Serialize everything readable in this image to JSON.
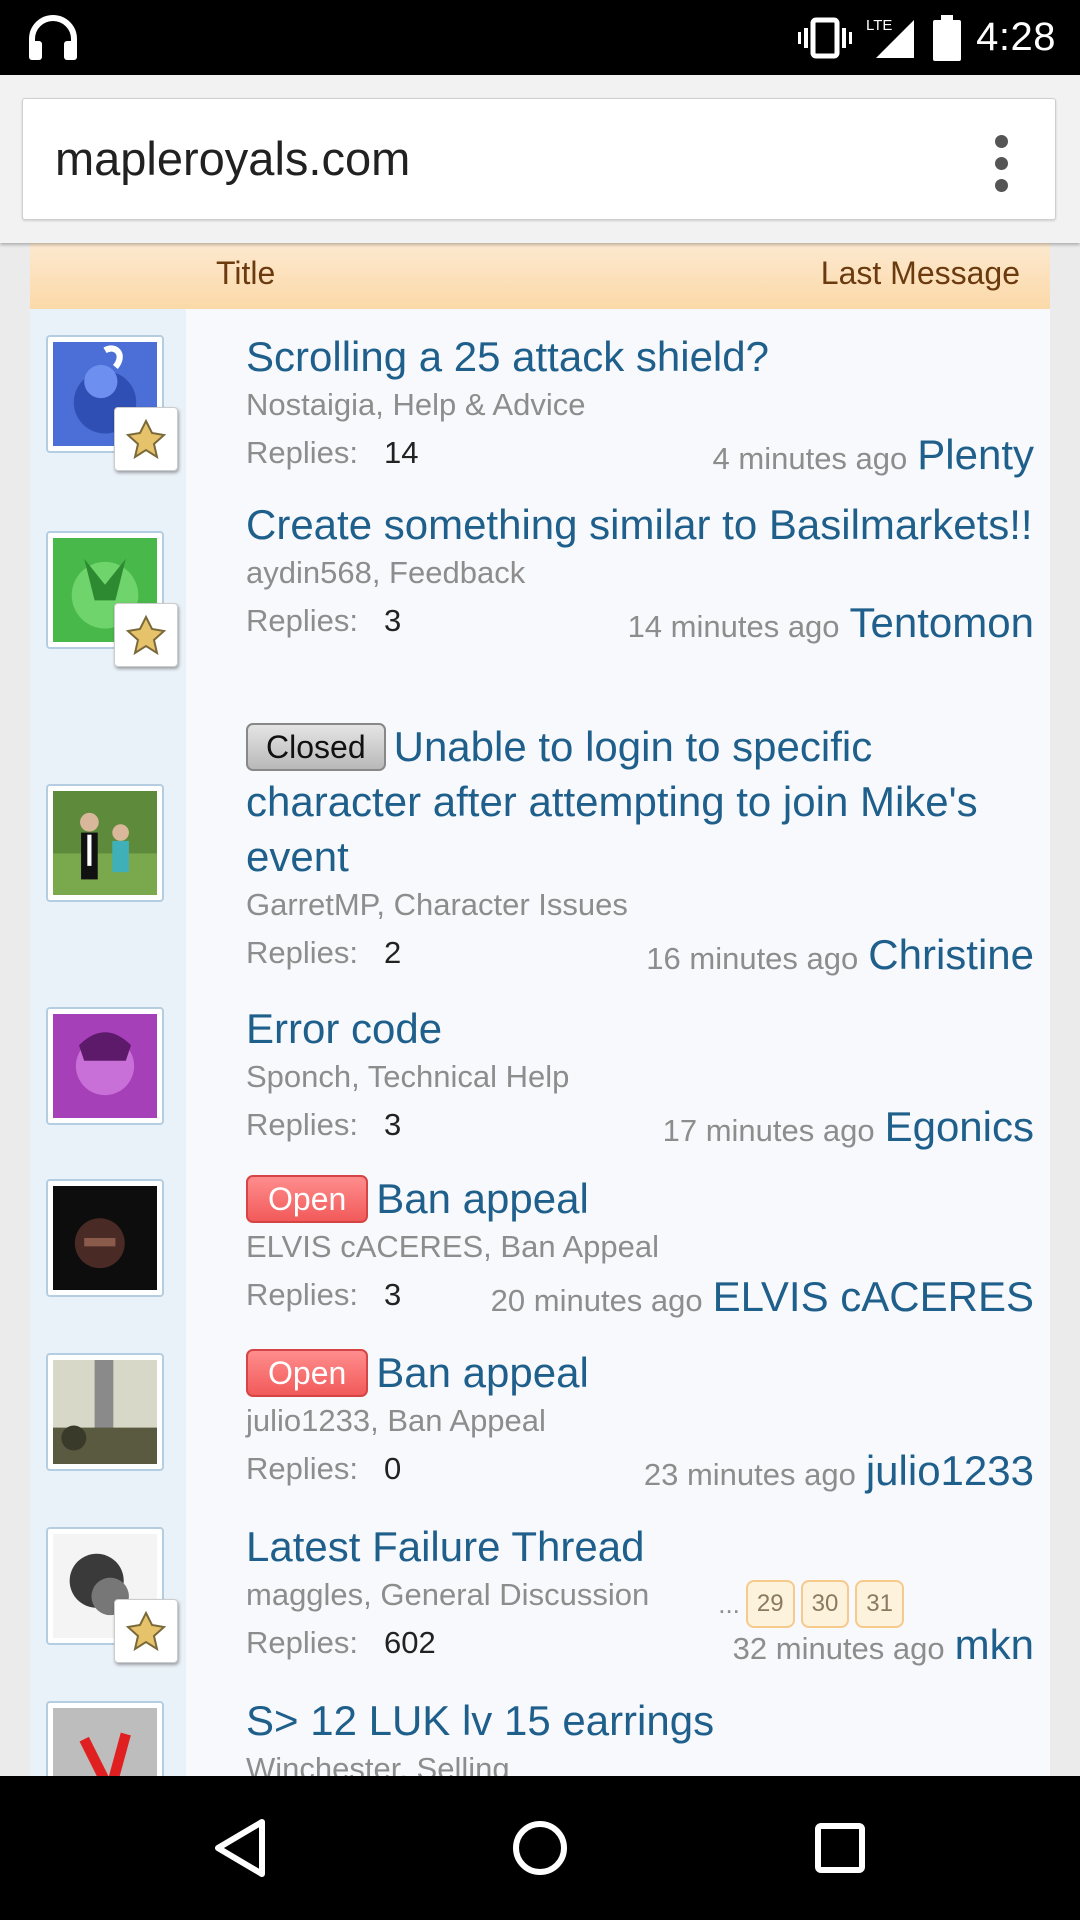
{
  "status_bar": {
    "time": "4:28",
    "network": "LTE"
  },
  "browser": {
    "url": "mapleroyals.com"
  },
  "list_header": {
    "title_label": "Title",
    "last_message_label": "Last Message"
  },
  "replies_label": "Replies:",
  "threads": [
    {
      "title": "Scrolling a 25 attack shield?",
      "prefix": "",
      "author_forum": "Nostaigia, Help & Advice",
      "replies": "14",
      "last_time": "4 minutes ago",
      "last_user": "Plenty",
      "pages": []
    },
    {
      "title": "Create something similar to Basilmarkets!!",
      "prefix": "",
      "author_forum": "aydin568, Feedback",
      "replies": "3",
      "last_time": "14 minutes ago",
      "last_user": "Tentomon",
      "pages": []
    },
    {
      "title": "Unable to login to specific character after attempting to join Mike's event",
      "prefix": "Closed",
      "author_forum": "GarretMP, Character Issues",
      "replies": "2",
      "last_time": "16 minutes ago",
      "last_user": "Christine",
      "pages": []
    },
    {
      "title": "Error code",
      "prefix": "",
      "author_forum": "Sponch, Technical Help",
      "replies": "3",
      "last_time": "17 minutes ago",
      "last_user": "Egonics",
      "pages": []
    },
    {
      "title": "Ban appeal",
      "prefix": "Open",
      "author_forum": "ELVIS cACERES, Ban Appeal",
      "replies": "3",
      "last_time": "20 minutes ago",
      "last_user": "ELVIS cACERES",
      "pages": []
    },
    {
      "title": "Ban appeal",
      "prefix": "Open",
      "author_forum": "julio1233, Ban Appeal",
      "replies": "0",
      "last_time": "23 minutes ago",
      "last_user": "julio1233",
      "pages": []
    },
    {
      "title": "Latest Failure Thread",
      "prefix": "",
      "author_forum": "maggles, General Discussion",
      "replies": "602",
      "last_time": "32 minutes ago",
      "last_user": "mkn",
      "pages_ellipsis": "...",
      "pages": [
        "29",
        "30",
        "31"
      ]
    },
    {
      "title": "S> 12 LUK lv 15 earrings",
      "prefix": "",
      "author_forum": "Winchester, Selling",
      "replies": "",
      "last_time": "",
      "last_user": "",
      "pages": []
    }
  ],
  "colors": {
    "link": "#1f5f8b",
    "header_bg": "#fbd9a8",
    "open_prefix": "#f25a5a",
    "closed_prefix": "#b9b9b9"
  },
  "icons": [
    "headphones-icon",
    "vibrate-icon",
    "signal-icon",
    "battery-icon",
    "overflow-menu-icon",
    "back-icon",
    "home-icon",
    "recents-icon",
    "staff-badge-icon"
  ]
}
